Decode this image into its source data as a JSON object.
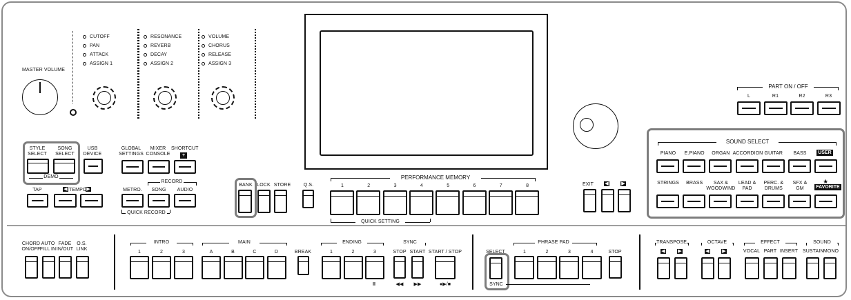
{
  "master_volume": "MASTER VOLUME",
  "knob_labels": [
    [
      "CUTOFF",
      "PAN",
      "ATTACK",
      "ASSIGN 1"
    ],
    [
      "RESONANCE",
      "REVERB",
      "DECAY",
      "ASSIGN 2"
    ],
    [
      "VOLUME",
      "CHORUS",
      "RELEASE",
      "ASSIGN 3"
    ]
  ],
  "left_buttons": {
    "style_select": "STYLE\nSELECT",
    "song_select": "SONG\nSELECT",
    "usb_device": "USB\nDEVICE",
    "demo": "DEMO",
    "tap": "TAP",
    "tempo": "TEMPO",
    "global_settings": "GLOBAL\nSETTINGS",
    "mixer_console": "MIXER\nCONSOLE",
    "shortcut": "SHORTCUT",
    "record": "RECORD",
    "metro": "METRO.",
    "song": "SONG",
    "audio": "AUDIO",
    "quick_record": "QUICK RECORD"
  },
  "center": {
    "bank": "BANK",
    "lock": "LOCK",
    "store": "STORE",
    "qs": "Q.S.",
    "performance_memory": "PERFORMANCE MEMORY",
    "pm_numbers": [
      "1",
      "2",
      "3",
      "4",
      "5",
      "6",
      "7",
      "8"
    ],
    "quick_setting": "QUICK SETTING"
  },
  "right": {
    "exit": "EXIT",
    "part_on_off": "PART ON / OFF",
    "parts": [
      "L",
      "R1",
      "R2",
      "R3"
    ],
    "sound_select": "SOUND SELECT",
    "sound_row1": [
      "PIANO",
      "E.PIANO",
      "ORGAN",
      "ACCORDION",
      "GUITAR",
      "BASS",
      "USER"
    ],
    "sound_row2": [
      "STRINGS",
      "BRASS",
      "SAX &\nWOODWIND",
      "LEAD &\nPAD",
      "PERC. &\nDRUMS",
      "SFX &\nGM",
      "FAVORITE"
    ]
  },
  "bottom": {
    "chord_on_off": "CHORD\nON/OFF",
    "auto_fill_in": "AUTO\nFILL IN",
    "fade_in_out": "FADE\nIN/OUT",
    "qs_link": "O.S.\nLINK",
    "intro": "INTRO",
    "intro_nums": [
      "1",
      "2",
      "3"
    ],
    "main": "MAIN",
    "main_letters": [
      "A",
      "B",
      "C",
      "D"
    ],
    "break": "BREAK",
    "ending": "ENDING",
    "ending_nums": [
      "1",
      "2",
      "3"
    ],
    "sync": "SYNC",
    "stop": "STOP",
    "start": "START",
    "start_stop": "START / STOP",
    "pause_sym": "II",
    "rew_sym": "◀◀",
    "ff_sym": "▶▶",
    "play_sym": "●▶/■",
    "phrase_pad": "PHRASE PAD",
    "select": "SELECT",
    "pad_nums": [
      "1",
      "2",
      "3",
      "4"
    ],
    "pad_stop": "STOP",
    "sync_label": "SYNC",
    "transpose": "TRANSPOSE",
    "octave": "OCTAVE",
    "effect": "EFFECT",
    "vocal": "VOCAL",
    "part": "PART",
    "insert": "INSERT",
    "sound": "SOUND",
    "sustain": "SUSTAIN",
    "mono": "MONO"
  }
}
